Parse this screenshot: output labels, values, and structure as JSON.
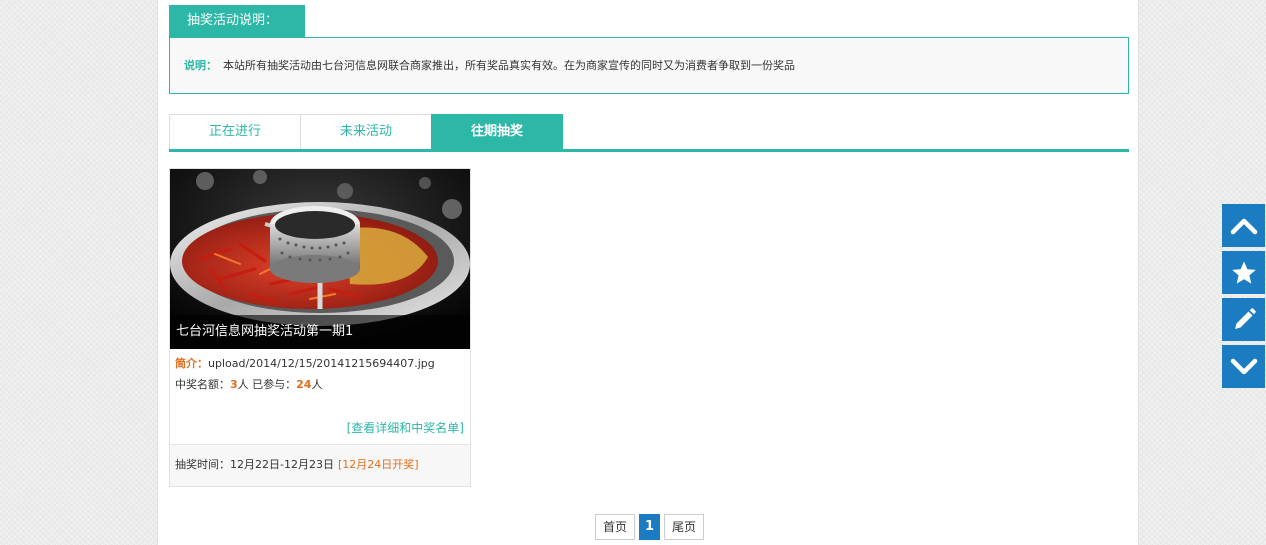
{
  "notice": {
    "tab_label": "抽奖活动说明：",
    "label": "说明：",
    "text": "本站所有抽奖活动由七台河信息网联合商家推出，所有奖品真实有效。在为商家宣传的同时又为消费者争取到一份奖品"
  },
  "tabs": [
    {
      "label": "正在进行",
      "active": false
    },
    {
      "label": "未来活动",
      "active": false
    },
    {
      "label": "往期抽奖",
      "active": true
    }
  ],
  "card": {
    "title": "七台河信息网抽奖活动第一期1",
    "intro_label": "简介：",
    "intro_value": "upload/2014/12/15/20141215694407.jpg",
    "quota_label": "中奖名额：",
    "quota_value": "3",
    "quota_unit": "人",
    "joined_label": "已参与：",
    "joined_value": "24",
    "joined_unit": "人",
    "detail_link": "[查看详细和中奖名单]",
    "time_text": "抽奖时间：12月22日-12月23日",
    "open_text": "[12月24日开奖]"
  },
  "pager": {
    "first": "首页",
    "current": "1",
    "last": "尾页"
  },
  "sidebar_icons": [
    "chevron-up-icon",
    "star-icon",
    "pencil-icon",
    "chevron-down-icon"
  ],
  "colors": {
    "accent": "#2db7a7",
    "blue": "#1b7cc1",
    "highlight": "#e26e1c"
  }
}
